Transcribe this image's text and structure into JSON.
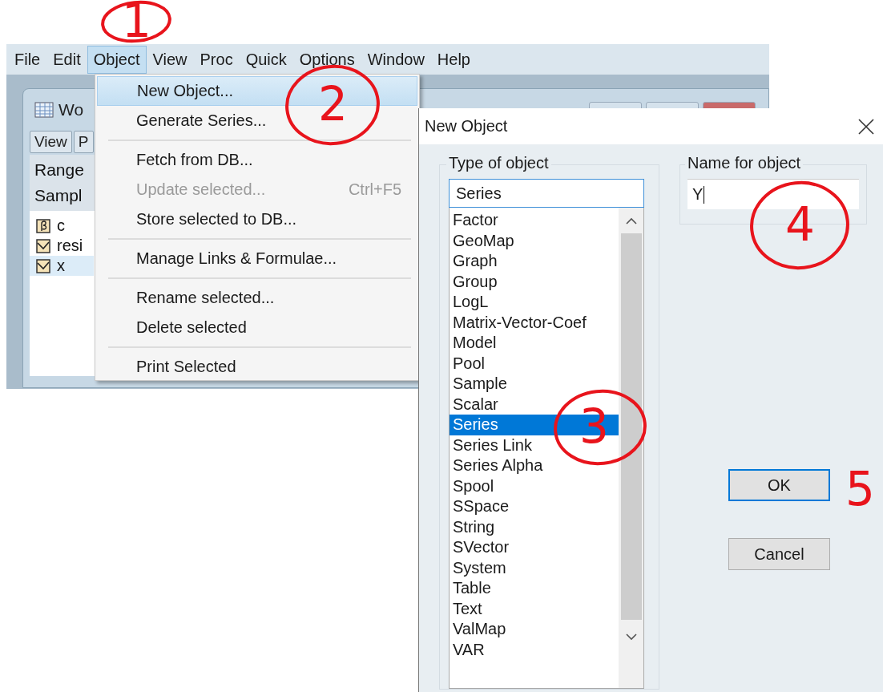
{
  "menu_bar": [
    {
      "label": "File",
      "selected": false
    },
    {
      "label": "Edit",
      "selected": false
    },
    {
      "label": "Object",
      "selected": true
    },
    {
      "label": "View",
      "selected": false
    },
    {
      "label": "Proc",
      "selected": false
    },
    {
      "label": "Quick",
      "selected": false
    },
    {
      "label": "Options",
      "selected": false
    },
    {
      "label": "Window",
      "selected": false
    },
    {
      "label": "Help",
      "selected": false
    }
  ],
  "workfile": {
    "title": "Wo",
    "toolbar": [
      "View",
      "P"
    ],
    "info": [
      "Range",
      "Sampl"
    ],
    "objects": [
      {
        "name": "c",
        "kind": "coef",
        "selected": false
      },
      {
        "name": "resi",
        "kind": "series",
        "selected": false
      },
      {
        "name": "x",
        "kind": "series",
        "selected": true
      }
    ]
  },
  "object_menu": {
    "items": [
      {
        "kind": "item",
        "label": "New Object...",
        "selected": true,
        "disabled": false
      },
      {
        "kind": "item",
        "label": "Generate Series...",
        "selected": false,
        "disabled": false
      },
      {
        "kind": "separator"
      },
      {
        "kind": "item",
        "label": "Fetch from DB...",
        "selected": false,
        "disabled": false
      },
      {
        "kind": "item",
        "label": "Update selected...",
        "shortcut": "Ctrl+F5",
        "selected": false,
        "disabled": true
      },
      {
        "kind": "item",
        "label": "Store selected to DB...",
        "selected": false,
        "disabled": false
      },
      {
        "kind": "separator"
      },
      {
        "kind": "item",
        "label": "Manage Links & Formulae...",
        "selected": false,
        "disabled": false
      },
      {
        "kind": "separator"
      },
      {
        "kind": "item",
        "label": "Rename selected...",
        "selected": false,
        "disabled": false
      },
      {
        "kind": "item",
        "label": "Delete selected",
        "selected": false,
        "disabled": false
      },
      {
        "kind": "separator"
      },
      {
        "kind": "item",
        "label": "Print Selected",
        "selected": false,
        "disabled": false
      }
    ]
  },
  "dialog": {
    "title": "New Object",
    "type_group": {
      "label": "Type of object",
      "value": "Series",
      "items": [
        {
          "label": "Factor",
          "selected": false
        },
        {
          "label": "GeoMap",
          "selected": false
        },
        {
          "label": "Graph",
          "selected": false
        },
        {
          "label": "Group",
          "selected": false
        },
        {
          "label": "LogL",
          "selected": false
        },
        {
          "label": "Matrix-Vector-Coef",
          "selected": false
        },
        {
          "label": "Model",
          "selected": false
        },
        {
          "label": "Pool",
          "selected": false
        },
        {
          "label": "Sample",
          "selected": false
        },
        {
          "label": "Scalar",
          "selected": false
        },
        {
          "label": "Series",
          "selected": true
        },
        {
          "label": "Series Link",
          "selected": false
        },
        {
          "label": "Series Alpha",
          "selected": false
        },
        {
          "label": "Spool",
          "selected": false
        },
        {
          "label": "SSpace",
          "selected": false
        },
        {
          "label": "String",
          "selected": false
        },
        {
          "label": "SVector",
          "selected": false
        },
        {
          "label": "System",
          "selected": false
        },
        {
          "label": "Table",
          "selected": false
        },
        {
          "label": "Text",
          "selected": false
        },
        {
          "label": "ValMap",
          "selected": false
        },
        {
          "label": "VAR",
          "selected": false
        }
      ]
    },
    "name_group": {
      "label": "Name for object",
      "value": "Y"
    },
    "buttons": [
      {
        "label": "OK",
        "default": true
      },
      {
        "label": "Cancel",
        "default": false
      }
    ]
  },
  "annotations": [
    {
      "label": "1",
      "kind": "circled"
    },
    {
      "label": "2",
      "kind": "circled"
    },
    {
      "label": "3",
      "kind": "circled"
    },
    {
      "label": "4",
      "kind": "circled"
    },
    {
      "label": "5",
      "kind": "plain"
    }
  ]
}
